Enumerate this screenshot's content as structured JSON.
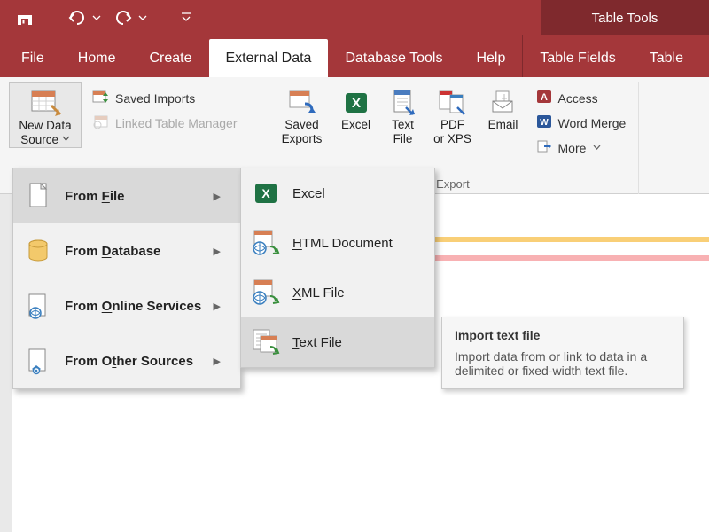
{
  "titlebar": {
    "table_tools": "Table Tools"
  },
  "tabs": {
    "file": "File",
    "home": "Home",
    "create": "Create",
    "external_data": "External Data",
    "database_tools": "Database Tools",
    "help": "Help",
    "table_fields": "Table Fields",
    "table": "Table"
  },
  "ribbon": {
    "import": {
      "new_data_source_l1": "New Data",
      "new_data_source_l2": "Source",
      "saved_imports": "Saved Imports",
      "linked_table_manager": "Linked Table Manager"
    },
    "export": {
      "saved_exports_l1": "Saved",
      "saved_exports_l2": "Exports",
      "excel": "Excel",
      "text_file_l1": "Text",
      "text_file_l2": "File",
      "pdf_l1": "PDF",
      "pdf_l2": "or XPS",
      "email": "Email",
      "access": "Access",
      "word_merge": "Word Merge",
      "more": "More",
      "group_label": "Export"
    }
  },
  "menu1": {
    "from_file_pre": "From ",
    "from_file_u": "F",
    "from_file_post": "ile",
    "from_database_pre": "From ",
    "from_database_u": "D",
    "from_database_post": "atabase",
    "from_online_pre": "From ",
    "from_online_u": "O",
    "from_online_post": "nline Services",
    "from_other_pre": "From O",
    "from_other_u": "t",
    "from_other_post": "her Sources"
  },
  "menu2": {
    "excel_u": "E",
    "excel_post": "xcel",
    "html_u": "H",
    "html_post": "TML Document",
    "xml_u": "X",
    "xml_post": "ML File",
    "text_u": "T",
    "text_post": "ext File"
  },
  "tooltip": {
    "title": "Import text file",
    "body": "Import data from or link to data in a delimited or fixed-width text file."
  }
}
